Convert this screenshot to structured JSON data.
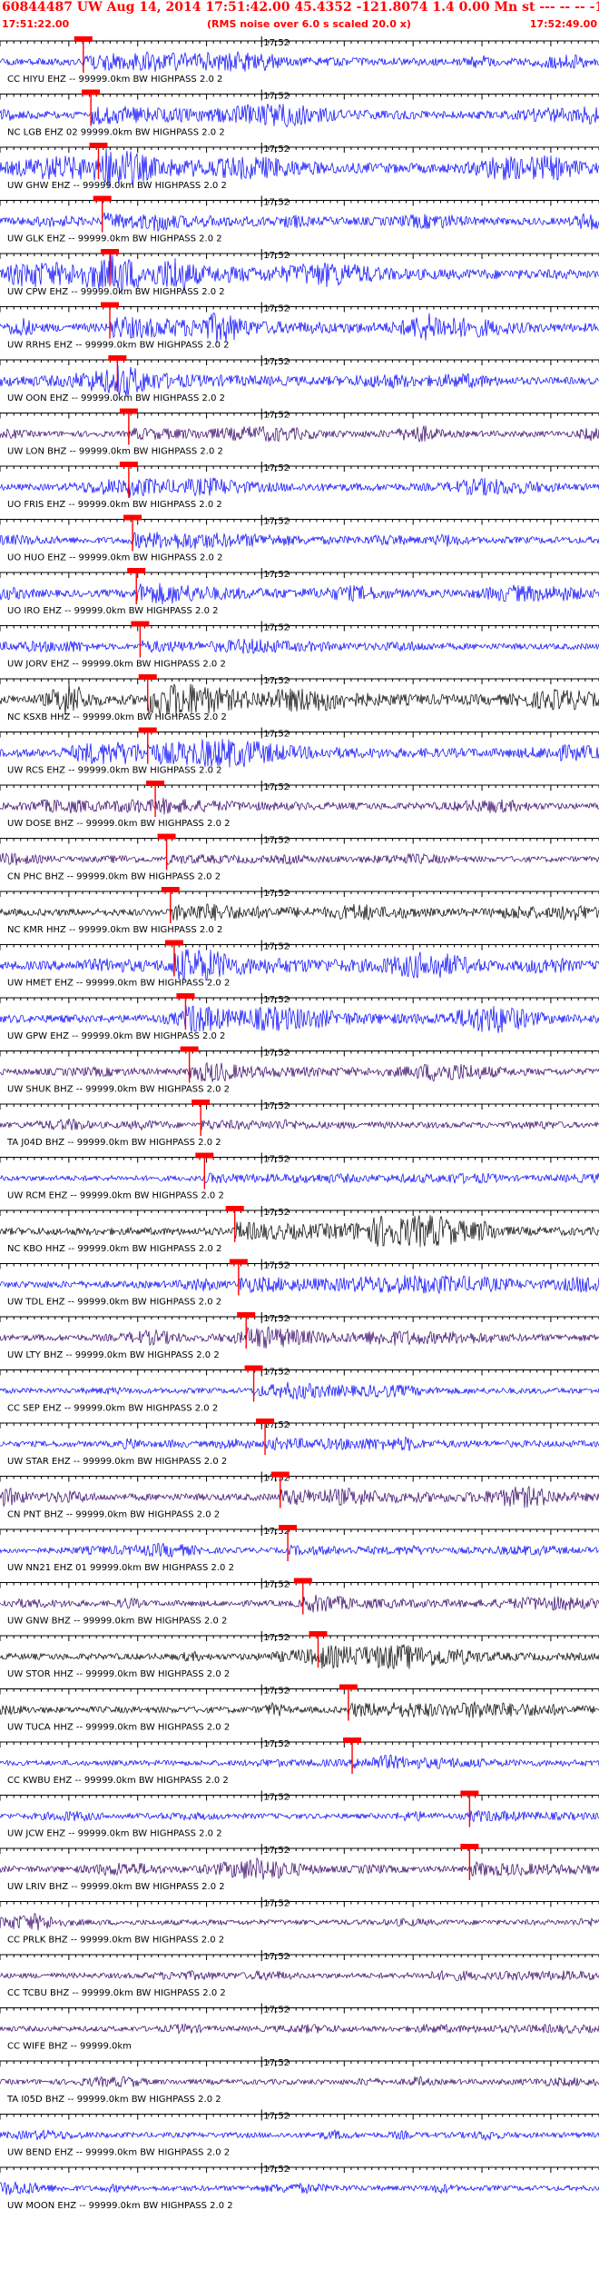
{
  "header": {
    "title": "60844487 UW Aug 14, 2014 17:51:42.00   45.4352 -121.8074  1.4 0.00 Mn st --- -- --  -1",
    "start_time": "17:51:22.00",
    "rms_note": "(RMS noise over 6.0 s scaled 20.0 x)",
    "end_time": "17:52:49.00"
  },
  "chart_data": {
    "type": "seismogram",
    "time_start": "17:51:22.00",
    "time_end": "17:52:49.00",
    "minute_mark": "17:52",
    "colors": {
      "blue": "#0000ff",
      "purple": "#330066",
      "black": "#000000",
      "pick": "#ff0000",
      "axis": "#000000"
    },
    "traces": [
      {
        "label": "CC HIYU EHZ -- 99999.0km BW  HIGHPASS  2.0  2",
        "color": "#0000ff",
        "pick_s": 22,
        "amp": 0.6
      },
      {
        "label": "NC LGB EHZ 02 99999.0km BW  HIGHPASS  2.0  2",
        "color": "#0000ff",
        "pick_s": 24,
        "amp": 0.7
      },
      {
        "label": "UW GHW EHZ -- 99999.0km BW  HIGHPASS  2.0  2",
        "color": "#0000ff",
        "pick_s": 26,
        "amp": 0.9
      },
      {
        "label": "UW GLK EHZ -- 99999.0km BW  HIGHPASS  2.0  2",
        "color": "#0000ff",
        "pick_s": 27,
        "amp": 0.6
      },
      {
        "label": "UW CPW EHZ -- 99999.0km BW  HIGHPASS  2.0  2",
        "color": "#0000ff",
        "pick_s": 29,
        "amp": 1.0
      },
      {
        "label": "UW RRHS EHZ -- 99999.0km BW  HIGHPASS  2.0  2",
        "color": "#0000ff",
        "pick_s": 29,
        "amp": 0.9
      },
      {
        "label": "UW OON EHZ -- 99999.0km BW  HIGHPASS  2.0  2",
        "color": "#0000ff",
        "pick_s": 31,
        "amp": 0.6
      },
      {
        "label": "UW LON BHZ -- 99999.0km BW  HIGHPASS  2.0  2",
        "color": "#330066",
        "pick_s": 34,
        "amp": 0.4
      },
      {
        "label": "UO FRIS EHZ -- 99999.0km BW  HIGHPASS  2.0  2",
        "color": "#0000ff",
        "pick_s": 34,
        "amp": 0.5
      },
      {
        "label": "UO HUO EHZ -- 99999.0km BW  HIGHPASS  2.0  2",
        "color": "#0000ff",
        "pick_s": 35,
        "amp": 0.5
      },
      {
        "label": "UO IRO EHZ -- 99999.0km BW  HIGHPASS  2.0  2",
        "color": "#0000ff",
        "pick_s": 36,
        "amp": 0.6
      },
      {
        "label": "UW JORV EHZ -- 99999.0km BW  HIGHPASS  2.0  2",
        "color": "#0000ff",
        "pick_s": 37,
        "amp": 0.4
      },
      {
        "label": "NC KSXB HHZ -- 99999.0km BW  HIGHPASS  2.0  2",
        "color": "#000000",
        "pick_s": 39,
        "amp": 1.0
      },
      {
        "label": "UW RCS EHZ -- 99999.0km BW  HIGHPASS  2.0  2",
        "color": "#0000ff",
        "pick_s": 39,
        "amp": 0.8
      },
      {
        "label": "UW DOSE BHZ -- 99999.0km BW  HIGHPASS  2.0  2",
        "color": "#330066",
        "pick_s": 41,
        "amp": 0.4
      },
      {
        "label": "CN PHC BHZ -- 99999.0km BW  HIGHPASS  2.0  2",
        "color": "#330066",
        "pick_s": 44,
        "amp": 0.3
      },
      {
        "label": "NC KMR HHZ -- 99999.0km BW  HIGHPASS  2.0  2",
        "color": "#000000",
        "pick_s": 45,
        "amp": 0.6
      },
      {
        "label": "UW HMET EHZ -- 99999.0km BW  HIGHPASS  2.0  2",
        "color": "#0000ff",
        "pick_s": 46,
        "amp": 0.9
      },
      {
        "label": "UW GPW EHZ -- 99999.0km BW  HIGHPASS  2.0  2",
        "color": "#0000ff",
        "pick_s": 49,
        "amp": 0.8
      },
      {
        "label": "UW SHUK BHZ -- 99999.0km BW  HIGHPASS  2.0  2",
        "color": "#330066",
        "pick_s": 50,
        "amp": 0.5
      },
      {
        "label": "TA J04D BHZ -- 99999.0km BW  HIGHPASS  2.0  2",
        "color": "#330066",
        "pick_s": 53,
        "amp": 0.3
      },
      {
        "label": "UW RCM EHZ -- 99999.0km BW  HIGHPASS  2.0  2",
        "color": "#0000ff",
        "pick_s": 54,
        "amp": 0.3
      },
      {
        "label": "NC KBO HHZ -- 99999.0km BW  HIGHPASS  2.0  2",
        "color": "#000000",
        "pick_s": 62,
        "amp": 0.7
      },
      {
        "label": "UW TDL EHZ -- 99999.0km BW  HIGHPASS  2.0  2",
        "color": "#0000ff",
        "pick_s": 63,
        "amp": 0.6
      },
      {
        "label": "UW LTY BHZ -- 99999.0km BW  HIGHPASS  2.0  2",
        "color": "#330066",
        "pick_s": 65,
        "amp": 0.5
      },
      {
        "label": "CC SEP EHZ -- 99999.0km BW  HIGHPASS  2.0  2",
        "color": "#0000ff",
        "pick_s": 67,
        "amp": 0.3
      },
      {
        "label": "UW STAR EHZ -- 99999.0km BW  HIGHPASS  2.0  2",
        "color": "#0000ff",
        "pick_s": 70,
        "amp": 0.4
      },
      {
        "label": "CN PNT BHZ -- 99999.0km BW  HIGHPASS  2.0  2",
        "color": "#330066",
        "pick_s": 74,
        "amp": 0.6
      },
      {
        "label": "UW NN21 EHZ 01 99999.0km BW  HIGHPASS  2.0  2",
        "color": "#0000ff",
        "pick_s": 76,
        "amp": 0.3
      },
      {
        "label": "UW GNW BHZ -- 99999.0km BW  HIGHPASS  2.0  2",
        "color": "#330066",
        "pick_s": 80,
        "amp": 0.4
      },
      {
        "label": "UW STOR HHZ -- 99999.0km BW  HIGHPASS  2.0  2",
        "color": "#000000",
        "pick_s": 84,
        "amp": 0.5
      },
      {
        "label": "UW TUCA HHZ -- 99999.0km BW  HIGHPASS  2.0  2",
        "color": "#000000",
        "pick_s": 92,
        "amp": 0.5
      },
      {
        "label": "CC KWBU EHZ -- 99999.0km BW  HIGHPASS  2.0  2",
        "color": "#0000ff",
        "pick_s": 93,
        "amp": 0.3
      },
      {
        "label": "UW JCW EHZ -- 99999.0km BW  HIGHPASS  2.0  2",
        "color": "#0000ff",
        "pick_s": 124,
        "amp": 0.3
      },
      {
        "label": "UW LRIV BHZ -- 99999.0km BW  HIGHPASS  2.0  2",
        "color": "#330066",
        "pick_s": 124,
        "amp": 0.5
      },
      {
        "label": "CC PRLK BHZ -- 99999.0km BW  HIGHPASS  2.0  2",
        "color": "#330066",
        "pick_s": null,
        "amp": 0.3
      },
      {
        "label": "CC TCBU BHZ -- 99999.0km BW  HIGHPASS  2.0  2",
        "color": "#330066",
        "pick_s": null,
        "amp": 0.3
      },
      {
        "label": "CC WIFE BHZ -- 99999.0km",
        "color": "#330066",
        "pick_s": null,
        "amp": 0.3
      },
      {
        "label": "TA I05D BHZ -- 99999.0km BW  HIGHPASS  2.0  2",
        "color": "#330066",
        "pick_s": null,
        "amp": 0.3
      },
      {
        "label": "UW BEND EHZ -- 99999.0km BW  HIGHPASS  2.0  2",
        "color": "#0000ff",
        "pick_s": null,
        "amp": 0.3
      },
      {
        "label": "UW MOON EHZ -- 99999.0km BW  HIGHPASS  2.0  2",
        "color": "#0000ff",
        "pick_s": null,
        "amp": 0.3
      }
    ]
  }
}
